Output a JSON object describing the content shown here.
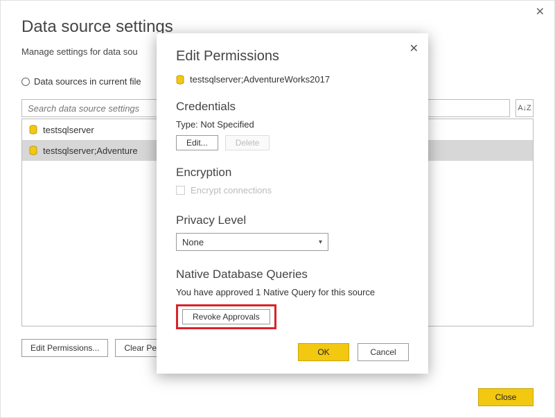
{
  "window": {
    "title": "Data source settings",
    "subtitle": "Manage settings for data sou",
    "radio_label": "Data sources in current file",
    "search_placeholder": "Search data source settings",
    "sort_glyph": "A↓Z",
    "items": [
      {
        "label": "testsqlserver"
      },
      {
        "label": "testsqlserver;Adventure"
      }
    ],
    "edit_permissions_btn": "Edit Permissions...",
    "clear_permissions_btn": "Clear Perm",
    "close_btn": "Close"
  },
  "dialog": {
    "title": "Edit Permissions",
    "source": "testsqlserver;AdventureWorks2017",
    "credentials": {
      "heading": "Credentials",
      "type_line": "Type: Not Specified",
      "edit_btn": "Edit...",
      "delete_btn": "Delete"
    },
    "encryption": {
      "heading": "Encryption",
      "checkbox_label": "Encrypt connections"
    },
    "privacy": {
      "heading": "Privacy Level",
      "selected": "None"
    },
    "native_queries": {
      "heading": "Native Database Queries",
      "status": "You have approved 1 Native Query for this source",
      "revoke_btn": "Revoke Approvals"
    },
    "ok_btn": "OK",
    "cancel_btn": "Cancel"
  }
}
